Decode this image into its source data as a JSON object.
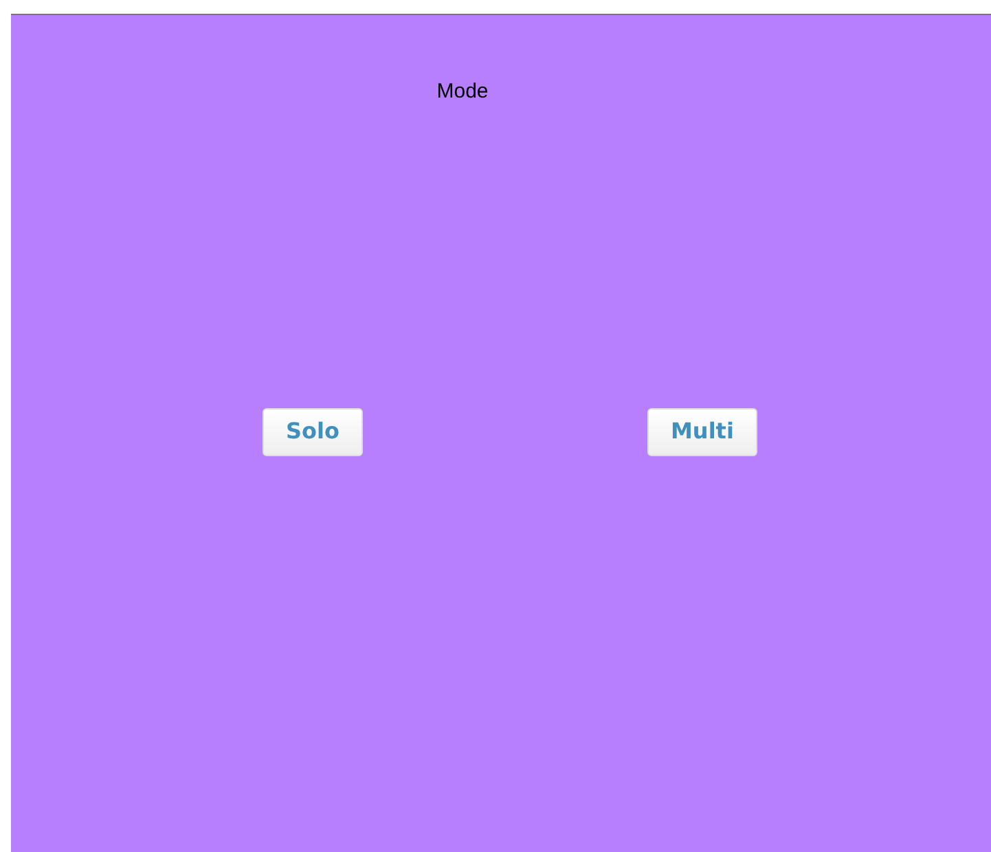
{
  "title": "Mode",
  "buttons": [
    {
      "label": "Solo"
    },
    {
      "label": "Multi"
    }
  ]
}
